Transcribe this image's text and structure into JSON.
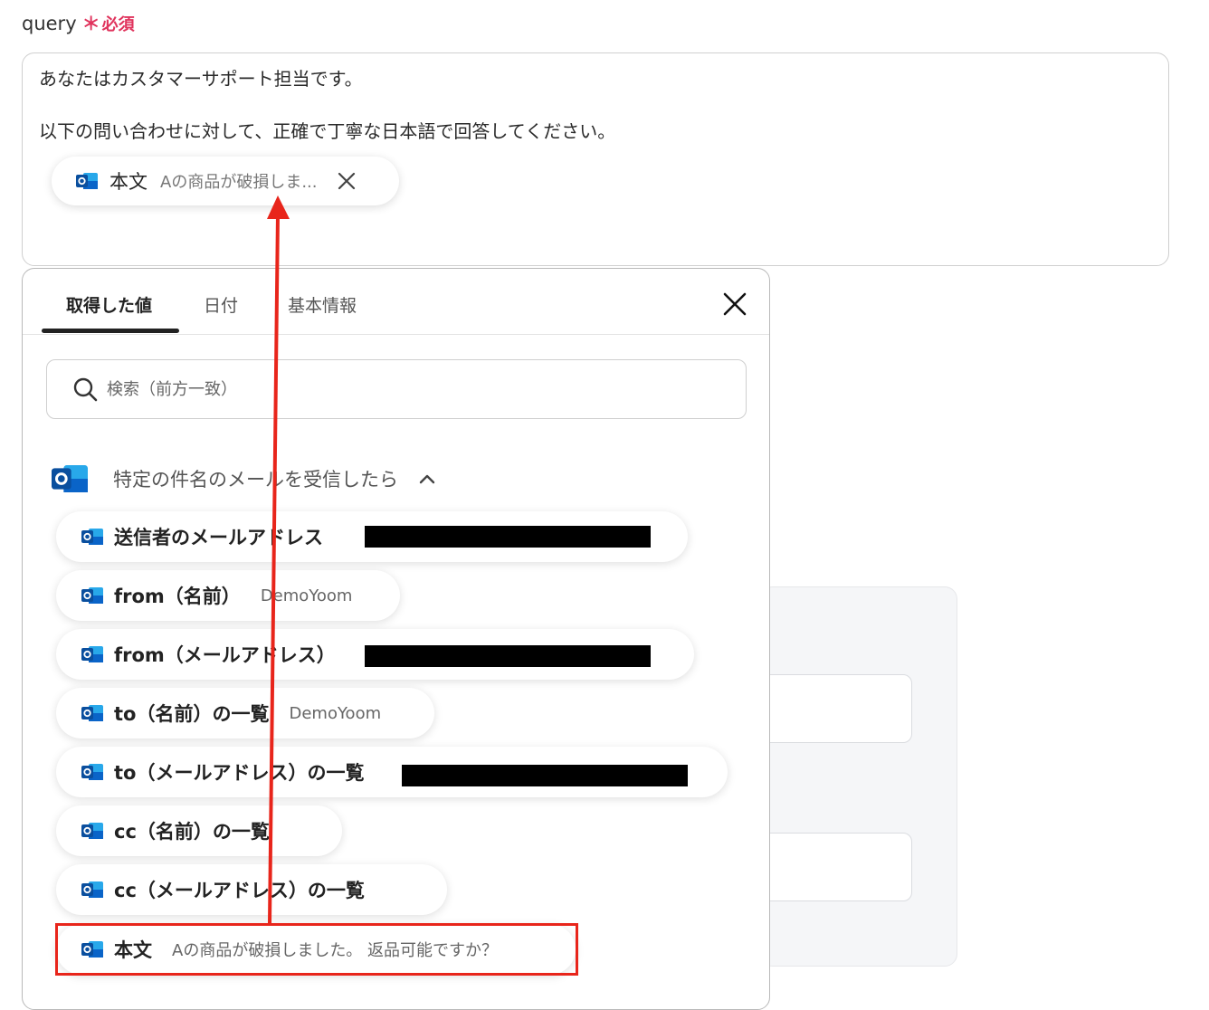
{
  "field": {
    "label": "query",
    "required_mark": "＊",
    "required_text": "必須"
  },
  "query": {
    "line1": "あなたはカスタマーサポート担当です。",
    "line2": "以下の問い合わせに対して、正確で丁寧な日本語で回答してください。",
    "chip": {
      "label": "本文",
      "value": "Aの商品が破損しま..."
    }
  },
  "popup": {
    "tabs": [
      {
        "label": "取得した値",
        "active": true
      },
      {
        "label": "日付",
        "active": false
      },
      {
        "label": "基本情報",
        "active": false
      }
    ],
    "search": {
      "placeholder": "検索（前方一致）"
    },
    "section": {
      "title": "特定の件名のメールを受信したら"
    },
    "items": [
      {
        "label": "送信者のメールアドレス",
        "value": ""
      },
      {
        "label": "from（名前）",
        "value": "DemoYoom"
      },
      {
        "label": "from（メールアドレス）",
        "value": ""
      },
      {
        "label": "to（名前）の一覧",
        "value": "DemoYoom"
      },
      {
        "label": "to（メールアドレス）の一覧",
        "value": ""
      },
      {
        "label": "cc（名前）の一覧",
        "value": ""
      },
      {
        "label": "cc（メールアドレス）の一覧",
        "value": ""
      },
      {
        "label": "本文",
        "value": "Aの商品が破損しました。 返品可能ですか？"
      }
    ]
  },
  "icons": {
    "app": "outlook-icon",
    "close": "close-icon",
    "search": "search-icon",
    "chevron": "chevron-up-icon"
  },
  "colors": {
    "required": "#e0335c",
    "annotation": "#e8251b",
    "outlook_blue": "#0a64c8"
  }
}
